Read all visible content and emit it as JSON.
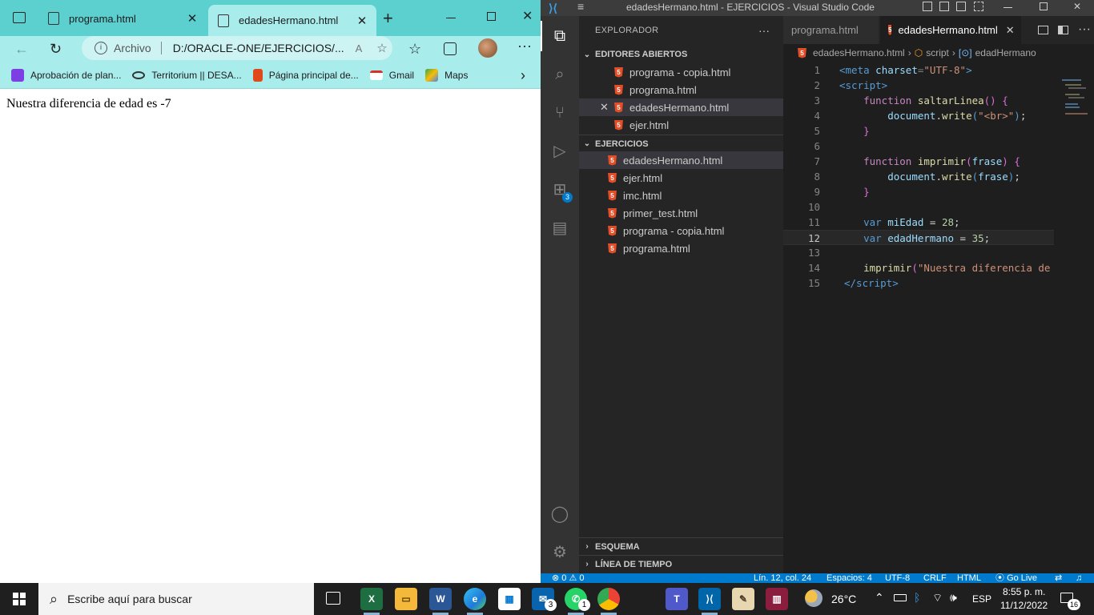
{
  "browser": {
    "tabs": [
      {
        "title": "programa.html",
        "close": "✕"
      },
      {
        "title": "edadesHermano.html",
        "close": "✕"
      }
    ],
    "new_tab": "+",
    "address": {
      "label": "Archivo",
      "url": "D:/ORACLE-ONE/EJERCICIOS/..."
    },
    "bookmarks": [
      {
        "label": "Aprobación de plan..."
      },
      {
        "label": "Territorium || DESA..."
      },
      {
        "label": "Página principal de..."
      },
      {
        "label": "Gmail"
      },
      {
        "label": "Maps"
      }
    ],
    "page_text": "Nuestra diferencia de edad es -7"
  },
  "vscode": {
    "title": "edadesHermano.html - EJERCICIOS - Visual Studio Code",
    "explorer": {
      "header": "EXPLORADOR",
      "more": "···",
      "open_editors_title": "EDITORES ABIERTOS",
      "open_editors": [
        "programa - copia.html",
        "programa.html",
        "edadesHermano.html",
        "ejer.html"
      ],
      "folder_title": "EJERCICIOS",
      "files": [
        "edadesHermano.html",
        "ejer.html",
        "imc.html",
        "primer_test.html",
        "programa - copia.html",
        "programa.html"
      ],
      "outline": "ESQUEMA",
      "timeline": "LÍNEA DE TIEMPO"
    },
    "editor_tabs": [
      {
        "title": "programa.html"
      },
      {
        "title": "edadesHermano.html",
        "close": "✕"
      }
    ],
    "breadcrumb": {
      "file": "edadesHermano.html",
      "sep": "›",
      "script": "script",
      "symbol": "edadHermano"
    },
    "line_numbers": [
      "1",
      "2",
      "3",
      "4",
      "5",
      "6",
      "7",
      "8",
      "9",
      "10",
      "11",
      "12",
      "13",
      "14",
      "15"
    ],
    "status": {
      "errors": "0",
      "warnings": "0",
      "position": "Lín. 12, col. 24",
      "spaces": "Espacios: 4",
      "encoding": "UTF-8",
      "eol": "CRLF",
      "language": "HTML",
      "golive": "Go Live"
    },
    "extensions_badge": "3"
  },
  "taskbar": {
    "search_placeholder": "Escribe aquí para buscar",
    "badges": {
      "mail": "3",
      "whatsapp": "1"
    },
    "weather": "26°C",
    "language": "ESP",
    "time": "8:55 p. m.",
    "date": "11/12/2022",
    "notifications": "16"
  },
  "colors": {
    "browser_accent": "#5ccfcf",
    "browser_toolbar": "#a9ecec",
    "vscode_bg": "#1e1e1e",
    "vscode_status": "#007acc"
  }
}
